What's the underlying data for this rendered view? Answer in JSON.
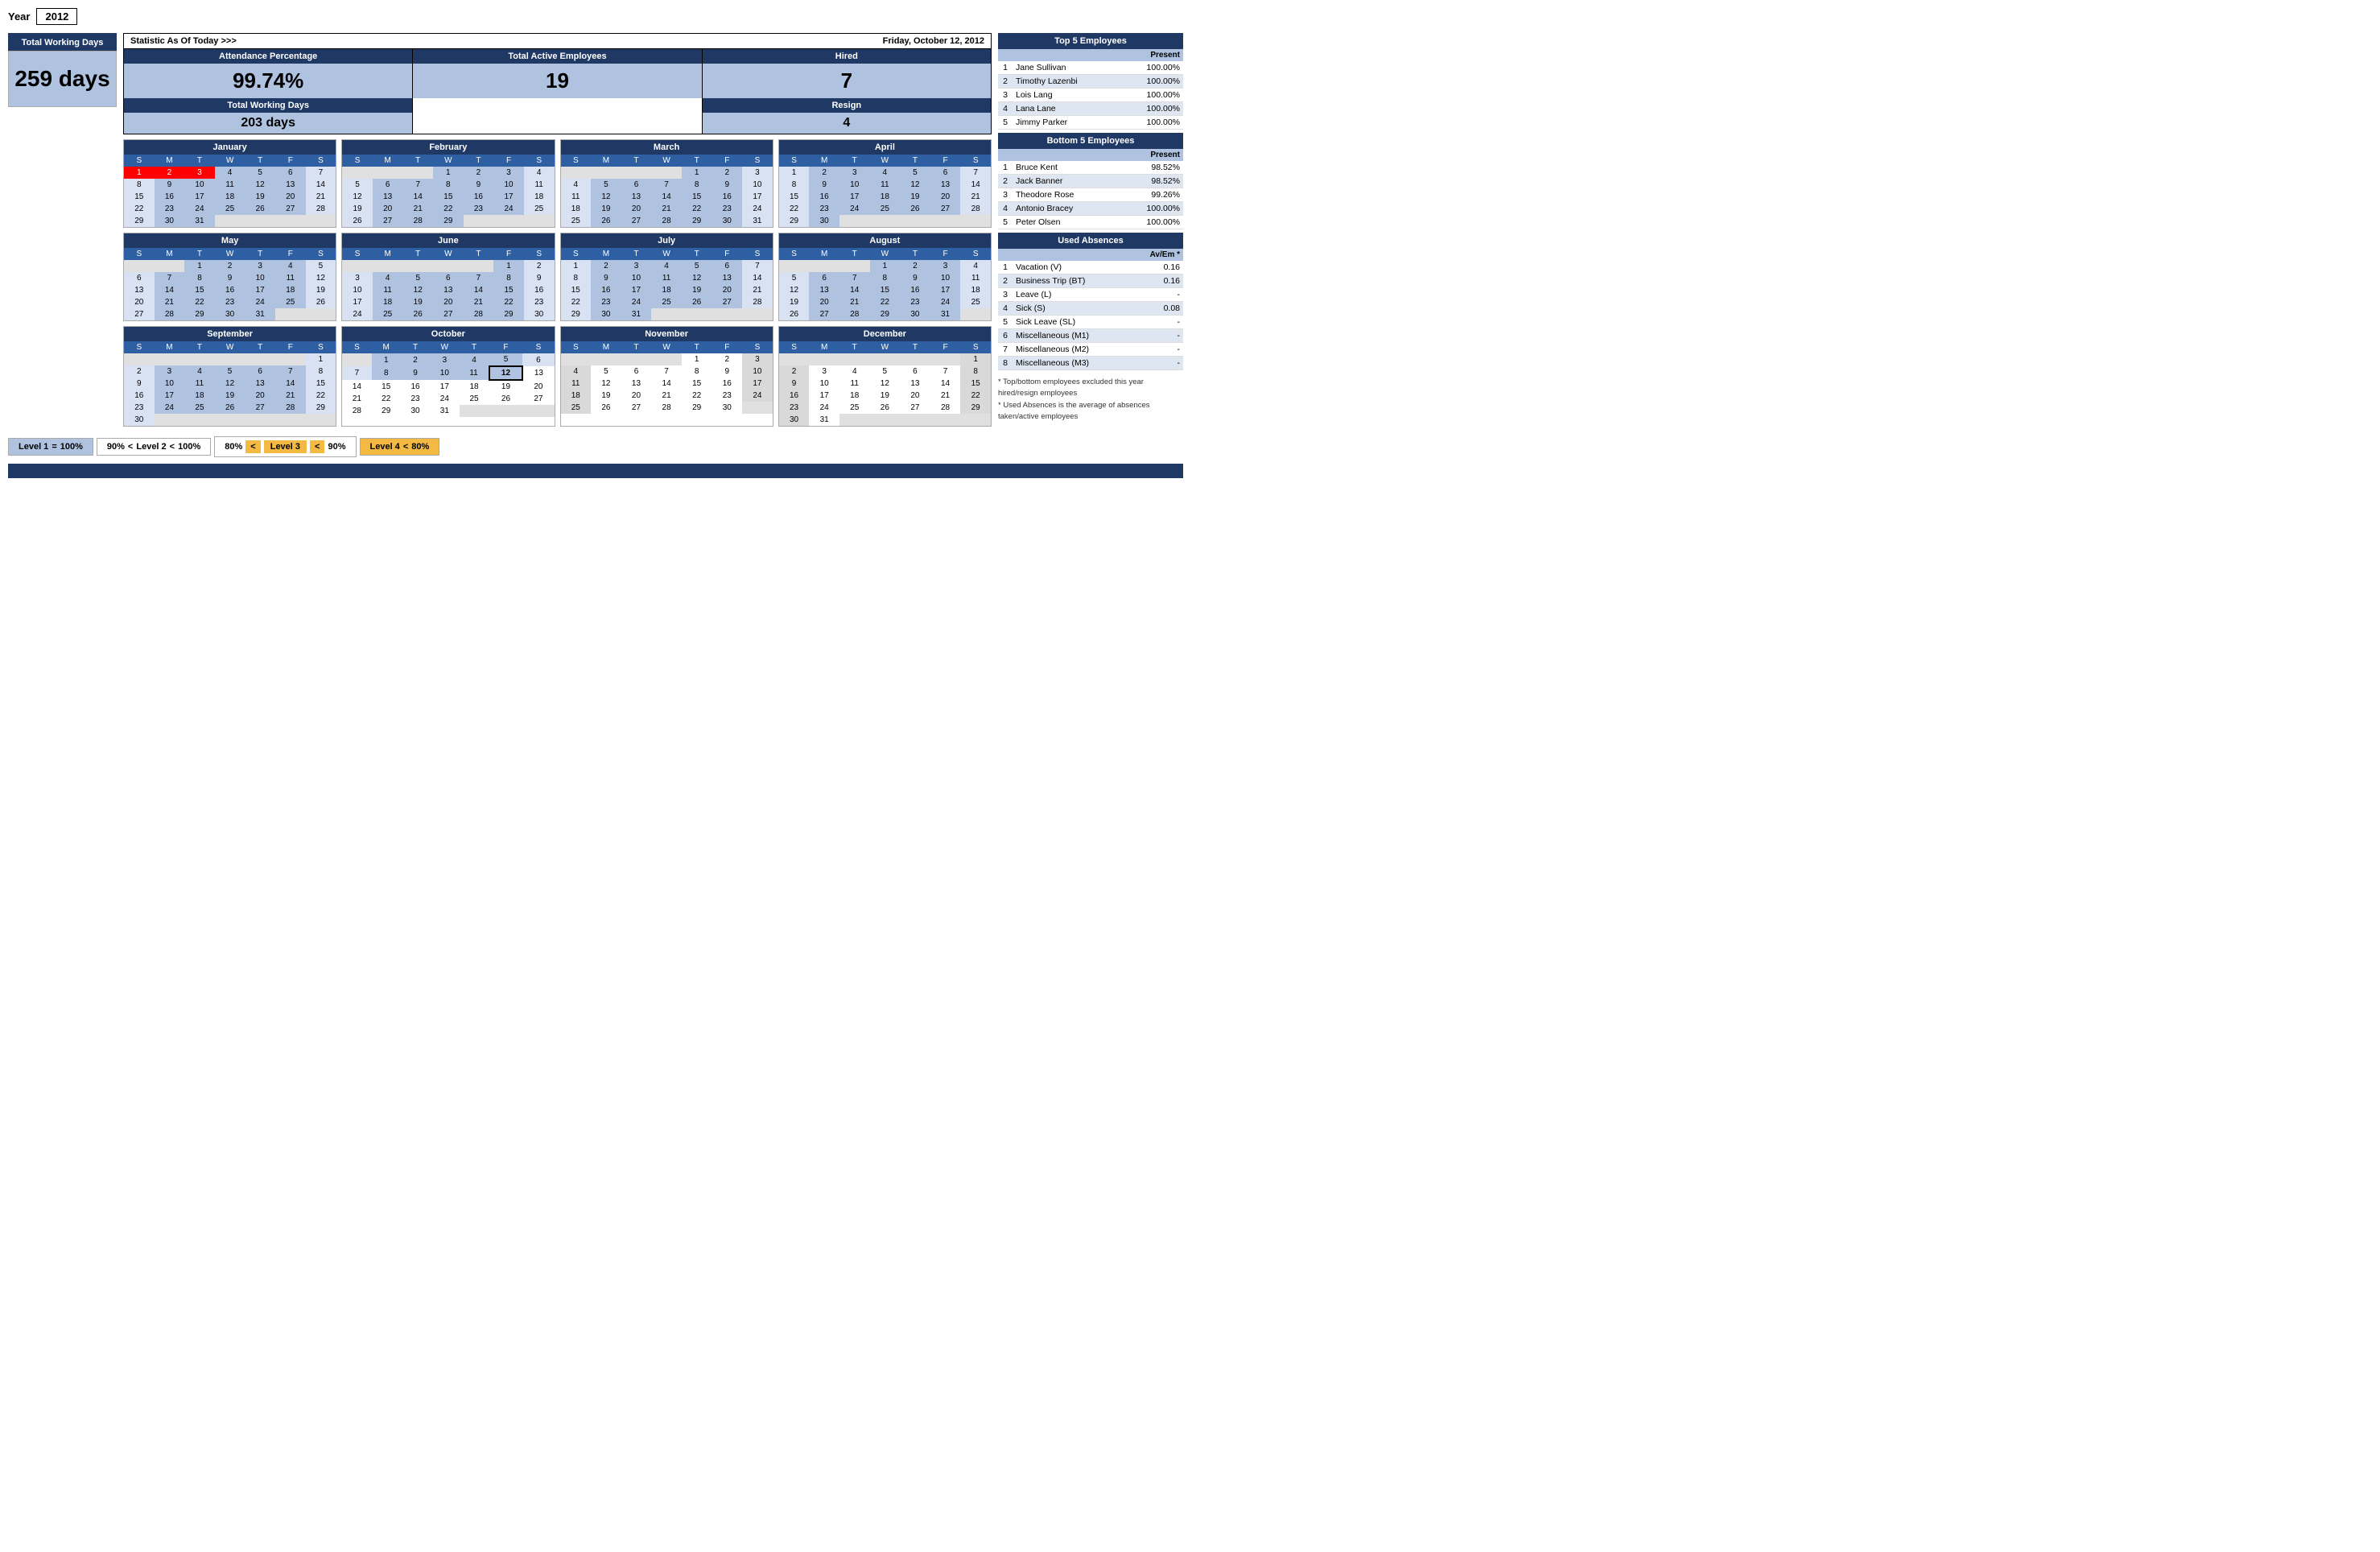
{
  "year": {
    "label": "Year",
    "value": "2012"
  },
  "totalWorkingDays": {
    "header": "Total Working Days",
    "value": "259 days"
  },
  "stats": {
    "title_left": "Statistic As Of Today   >>>",
    "title_right": "Friday, October 12, 2012",
    "attendance": {
      "header": "Attendance Percentage",
      "value": "99.74%",
      "sub_header": "Total Working Days",
      "sub_value": "203 days"
    },
    "active_employees": {
      "header": "Total Active Employees",
      "value": "19"
    },
    "hired": {
      "header": "Hired",
      "value": "7",
      "sub_header": "Resign",
      "sub_value": "4"
    }
  },
  "top5": {
    "title": "Top 5 Employees",
    "col_present": "Present",
    "employees": [
      {
        "rank": "1",
        "name": "Jane Sullivan",
        "present": "100.00%"
      },
      {
        "rank": "2",
        "name": "Timothy Lazenbi",
        "present": "100.00%"
      },
      {
        "rank": "3",
        "name": "Lois Lang",
        "present": "100.00%"
      },
      {
        "rank": "4",
        "name": "Lana Lane",
        "present": "100.00%"
      },
      {
        "rank": "5",
        "name": "Jimmy Parker",
        "present": "100.00%"
      }
    ]
  },
  "bottom5": {
    "title": "Bottom 5 Employees",
    "col_present": "Present",
    "employees": [
      {
        "rank": "1",
        "name": "Bruce Kent",
        "present": "98.52%"
      },
      {
        "rank": "2",
        "name": "Jack Banner",
        "present": "98.52%"
      },
      {
        "rank": "3",
        "name": "Theodore Rose",
        "present": "99.26%"
      },
      {
        "rank": "4",
        "name": "Antonio Bracey",
        "present": "100.00%"
      },
      {
        "rank": "5",
        "name": "Peter Olsen",
        "present": "100.00%"
      }
    ]
  },
  "absences": {
    "title": "Used Absences",
    "col_av": "Av/Em *",
    "items": [
      {
        "rank": "1",
        "name": "Vacation (V)",
        "value": "0.16"
      },
      {
        "rank": "2",
        "name": "Business Trip (BT)",
        "value": "0.16"
      },
      {
        "rank": "3",
        "name": "Leave (L)",
        "value": "-"
      },
      {
        "rank": "4",
        "name": "Sick (S)",
        "value": "0.08"
      },
      {
        "rank": "5",
        "name": "Sick Leave (SL)",
        "value": "-"
      },
      {
        "rank": "6",
        "name": "Miscellaneous (M1)",
        "value": "-"
      },
      {
        "rank": "7",
        "name": "Miscellaneous (M2)",
        "value": "-"
      },
      {
        "rank": "8",
        "name": "Miscellaneous (M3)",
        "value": "-"
      }
    ]
  },
  "footnotes": {
    "line1": "* Top/bottom employees excluded this year hired/resign employees",
    "line2": "* Used Absences is the average of absences taken/active employees"
  },
  "legend": {
    "level1_label": "Level 1",
    "level1_eq": "=",
    "level1_val": "100%",
    "level2_low": "90%",
    "level2_lt1": "<",
    "level2_label": "Level 2",
    "level2_lt2": "<",
    "level2_high": "100%",
    "level3_low": "80%",
    "level3_lt1": "<",
    "level3_label": "Level 3",
    "level3_lt2": "<",
    "level3_high": "90%",
    "level4_label": "Level 4",
    "level4_lt": "<",
    "level4_val": "80%"
  },
  "calendars": {
    "january": {
      "name": "January",
      "weeks": [
        [
          "1r",
          "2r",
          "3",
          "4",
          "5",
          "6",
          "7"
        ],
        [
          "8",
          "9",
          "10",
          "11",
          "12",
          "13",
          "14"
        ],
        [
          "15",
          "16",
          "17",
          "18",
          "19",
          "20",
          "21"
        ],
        [
          "22",
          "23",
          "24",
          "25",
          "26",
          "27",
          "28"
        ],
        [
          "29",
          "30",
          "31",
          "",
          "",
          "",
          ""
        ]
      ]
    },
    "february": {
      "name": "February",
      "weeks": [
        [
          "",
          "",
          "",
          "1",
          "2",
          "3",
          "4"
        ],
        [
          "5",
          "6",
          "7",
          "8",
          "9",
          "10",
          "11"
        ],
        [
          "12",
          "13",
          "14",
          "15",
          "16",
          "17",
          "18"
        ],
        [
          "19",
          "20",
          "21",
          "22",
          "23",
          "24",
          "25"
        ],
        [
          "26",
          "27",
          "28",
          "29",
          "",
          "",
          ""
        ]
      ]
    },
    "march": {
      "name": "March",
      "weeks": [
        [
          "",
          "",
          "",
          "",
          "1",
          "2",
          "3"
        ],
        [
          "4",
          "5",
          "6",
          "7",
          "8",
          "9",
          "10"
        ],
        [
          "11",
          "12",
          "13",
          "14",
          "15",
          "16",
          "17"
        ],
        [
          "18",
          "19",
          "20",
          "21",
          "22",
          "23",
          "24"
        ],
        [
          "25",
          "26",
          "27",
          "28",
          "29",
          "30",
          "31"
        ]
      ]
    },
    "april": {
      "name": "April",
      "weeks": [
        [
          "1",
          "2",
          "3",
          "4",
          "5",
          "6",
          "7"
        ],
        [
          "8",
          "9",
          "10",
          "11",
          "12",
          "13",
          "14"
        ],
        [
          "15",
          "16",
          "17",
          "18",
          "19",
          "20",
          "21"
        ],
        [
          "22",
          "23",
          "24",
          "25",
          "26",
          "27",
          "28"
        ],
        [
          "29",
          "30",
          "",
          "",
          "",
          "",
          ""
        ]
      ]
    },
    "may": {
      "name": "May",
      "weeks": [
        [
          "",
          "",
          "1",
          "2",
          "3",
          "4",
          "5"
        ],
        [
          "6",
          "7",
          "8",
          "9",
          "10",
          "11",
          "12"
        ],
        [
          "13",
          "14",
          "15",
          "16",
          "17",
          "18",
          "19"
        ],
        [
          "20",
          "21",
          "22",
          "23",
          "24",
          "25",
          "26"
        ],
        [
          "27",
          "28",
          "29",
          "30",
          "31",
          "",
          ""
        ]
      ]
    },
    "june": {
      "name": "June",
      "weeks": [
        [
          "",
          "",
          "",
          "",
          "",
          "1",
          "2"
        ],
        [
          "3",
          "4",
          "5",
          "6",
          "7",
          "8",
          "9"
        ],
        [
          "10",
          "11",
          "12",
          "13",
          "14",
          "15",
          "16"
        ],
        [
          "17",
          "18",
          "19",
          "20",
          "21",
          "22",
          "23"
        ],
        [
          "24",
          "25",
          "26",
          "27",
          "28",
          "29",
          "30"
        ]
      ]
    },
    "july": {
      "name": "July",
      "weeks": [
        [
          "1",
          "2",
          "3",
          "4",
          "5",
          "6",
          "7"
        ],
        [
          "8",
          "9",
          "10",
          "11",
          "12",
          "13",
          "14"
        ],
        [
          "15",
          "16",
          "17",
          "18",
          "19",
          "20",
          "21"
        ],
        [
          "22",
          "23",
          "24",
          "25",
          "26",
          "27",
          "28"
        ],
        [
          "29",
          "30",
          "31",
          "",
          "",
          "",
          ""
        ]
      ]
    },
    "august": {
      "name": "August",
      "weeks": [
        [
          "",
          "",
          "",
          "1",
          "2",
          "3",
          "4"
        ],
        [
          "5",
          "6",
          "7",
          "8",
          "9",
          "10",
          "11"
        ],
        [
          "12",
          "13",
          "14",
          "15",
          "16",
          "17",
          "18"
        ],
        [
          "19",
          "20",
          "21",
          "22",
          "23",
          "24",
          "25"
        ],
        [
          "26",
          "27",
          "28",
          "29",
          "30",
          "31",
          ""
        ]
      ]
    },
    "september": {
      "name": "September",
      "weeks": [
        [
          "",
          "",
          "",
          "",
          "",
          "",
          "1"
        ],
        [
          "2",
          "3",
          "4",
          "5",
          "6",
          "7",
          "8"
        ],
        [
          "9",
          "10",
          "11",
          "12",
          "13",
          "14",
          "15"
        ],
        [
          "16",
          "17",
          "18",
          "19",
          "20",
          "21",
          "22"
        ],
        [
          "23",
          "24",
          "25",
          "26",
          "27",
          "28",
          "29"
        ],
        [
          "30",
          "",
          "",
          "",
          "",
          "",
          ""
        ]
      ]
    },
    "october": {
      "name": "October",
      "weeks": [
        [
          "",
          "1",
          "2",
          "3",
          "4",
          "5",
          "6"
        ],
        [
          "7",
          "8",
          "9",
          "10",
          "11",
          "12t",
          "13"
        ],
        [
          "14",
          "15",
          "16",
          "17",
          "18",
          "19",
          "20"
        ],
        [
          "21",
          "22",
          "23",
          "24",
          "25",
          "26",
          "27"
        ],
        [
          "28",
          "29",
          "30",
          "31",
          "",
          "",
          ""
        ]
      ]
    },
    "november": {
      "name": "November",
      "weeks": [
        [
          "",
          "",
          "",
          "",
          "1",
          "2",
          "3"
        ],
        [
          "4",
          "5",
          "6",
          "7",
          "8",
          "9",
          "10"
        ],
        [
          "11",
          "12",
          "13",
          "14",
          "15",
          "16",
          "17"
        ],
        [
          "18",
          "19",
          "20",
          "21",
          "22",
          "23",
          "24"
        ],
        [
          "25",
          "26",
          "27",
          "28",
          "29",
          "30",
          ""
        ]
      ]
    },
    "december": {
      "name": "December",
      "weeks": [
        [
          "",
          "",
          "",
          "",
          "",
          "",
          "1"
        ],
        [
          "2",
          "3",
          "4",
          "5",
          "6",
          "7",
          "8"
        ],
        [
          "9",
          "10",
          "11",
          "12",
          "13",
          "14",
          "15"
        ],
        [
          "16",
          "17",
          "18",
          "19",
          "20",
          "21",
          "22"
        ],
        [
          "23",
          "24",
          "25",
          "26",
          "27",
          "28",
          "29"
        ],
        [
          "30",
          "31",
          "",
          "",
          "",
          "",
          ""
        ]
      ]
    }
  }
}
